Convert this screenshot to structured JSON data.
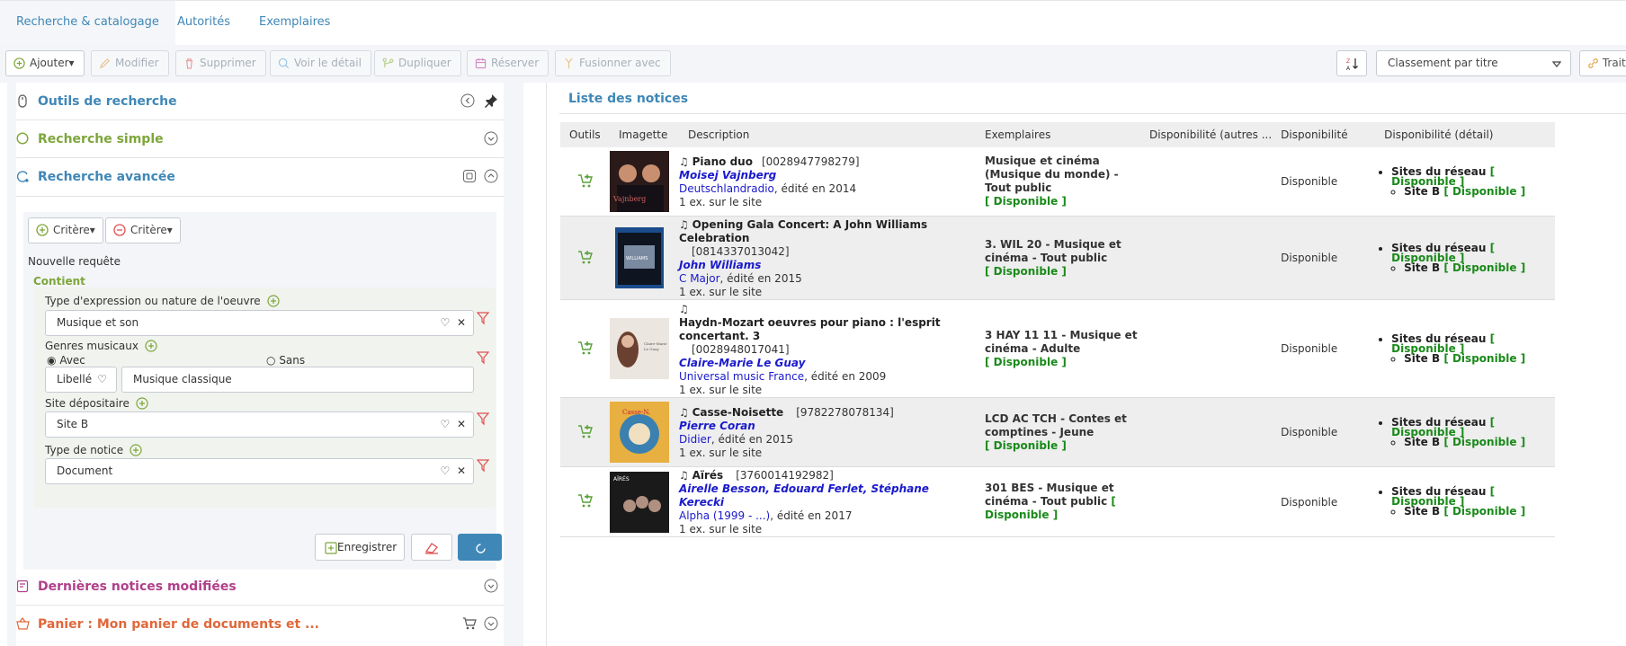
{
  "tabs": [
    "Recherche & catalogage",
    "Autorités",
    "Exemplaires"
  ],
  "toolbar": {
    "add": "Ajouter",
    "modify": "Modifier",
    "delete": "Supprimer",
    "view": "Voir le détail",
    "duplicate": "Dupliquer",
    "reserve": "Réserver",
    "merge": "Fusionner avec",
    "sort_value": "Classement par titre",
    "process": "Traitement"
  },
  "left": {
    "tools_title": "Outils de recherche",
    "simple_title": "Recherche simple",
    "advanced_title": "Recherche avancée",
    "crit_add": "Critère",
    "crit_remove": "Critère",
    "new_query": "Nouvelle requête",
    "contains": "Contient",
    "f1_label": "Type d'expression ou nature de l'oeuvre",
    "f1_value": "Musique et son",
    "f2_label": "Genres musicaux",
    "f2_with": "Avec",
    "f2_without": "Sans",
    "f2_select": "Libellé",
    "f2_value": "Musique classique",
    "f3_label": "Site dépositaire",
    "f3_value": "Site B",
    "f4_label": "Type de notice",
    "f4_value": "Document",
    "save": "Enregistrer",
    "last_modified": "Dernières notices modifiées",
    "basket": "Panier : Mon panier de documents et ..."
  },
  "right": {
    "title": "Liste des notices",
    "headers": [
      "Outils",
      "Imagette",
      "Description",
      "Exemplaires",
      "Disponibilité (autres ...",
      "Disponibilité",
      "Disponibilité (détail)"
    ],
    "rows": [
      {
        "title": "Piano duo",
        "code": "[0028947798279]",
        "authors": "Moisej Vajnberg",
        "publisher": "Deutschlandradio",
        "edited": ", édité en 2014",
        "copies": "1 ex. sur le site",
        "ex": "Musique et cinéma (Musique du monde) - Tout public",
        "ex_dispo": "[ Disponible ]",
        "dispo": "Disponible",
        "net": "Sites du réseau",
        "site": "Site B",
        "tag": "[ Disponible ]"
      },
      {
        "title": "Opening Gala Concert: A John Williams Celebration",
        "code": "[0814337013042]",
        "authors": "John Williams",
        "publisher": "C Major",
        "edited": ", édité en 2015",
        "copies": "1 ex. sur le site",
        "ex": "3. WIL 20 - Musique et cinéma - Tout public",
        "ex_dispo": "[ Disponible ]",
        "dispo": "Disponible",
        "net": "Sites du réseau",
        "site": "Site B",
        "tag": "[ Disponible ]"
      },
      {
        "title": "Haydn-Mozart oeuvres pour piano : l'esprit concertant. 3",
        "code": "[0028948017041]",
        "authors": "Claire-Marie Le Guay",
        "publisher": "Universal music France",
        "edited": ", édité en 2009",
        "copies": "1 ex. sur le site",
        "ex": "3 HAY 11 11 - Musique et cinéma - Adulte",
        "ex_dispo": "[ Disponible ]",
        "dispo": "Disponible",
        "net": "Sites du réseau",
        "site": "Site B",
        "tag": "[ Disponible ]"
      },
      {
        "title": "Casse-Noisette",
        "code": "[9782278078134]",
        "authors": "Pierre Coran",
        "publisher": "Didier",
        "edited": ", édité en 2015",
        "copies": "1 ex. sur le site",
        "ex": "LCD AC TCH - Contes et comptines - Jeune",
        "ex_dispo": "[ Disponible ]",
        "dispo": "Disponible",
        "net": "Sites du réseau",
        "site": "Site B",
        "tag": "[ Disponible ]"
      },
      {
        "title": "Aïrés",
        "code": "[3760014192982]",
        "authors": "Airelle Besson, Edouard Ferlet, Stéphane Kerecki",
        "publisher": "Alpha (1999 - ...)",
        "edited": ", édité en 2017",
        "copies": "1 ex. sur le site",
        "ex": "301 BES - Musique et cinéma - Tout public",
        "ex_dispo": "[ Disponible ]",
        "dispo": "Disponible",
        "net": "Sites du réseau",
        "site": "Site B",
        "tag": "[ Disponible ]"
      }
    ]
  },
  "colors": {
    "blue": "#3f87b7",
    "green": "#7da63a",
    "magenta": "#b0408a",
    "orange": "#e0673a",
    "avail": "#1a8a1a"
  }
}
